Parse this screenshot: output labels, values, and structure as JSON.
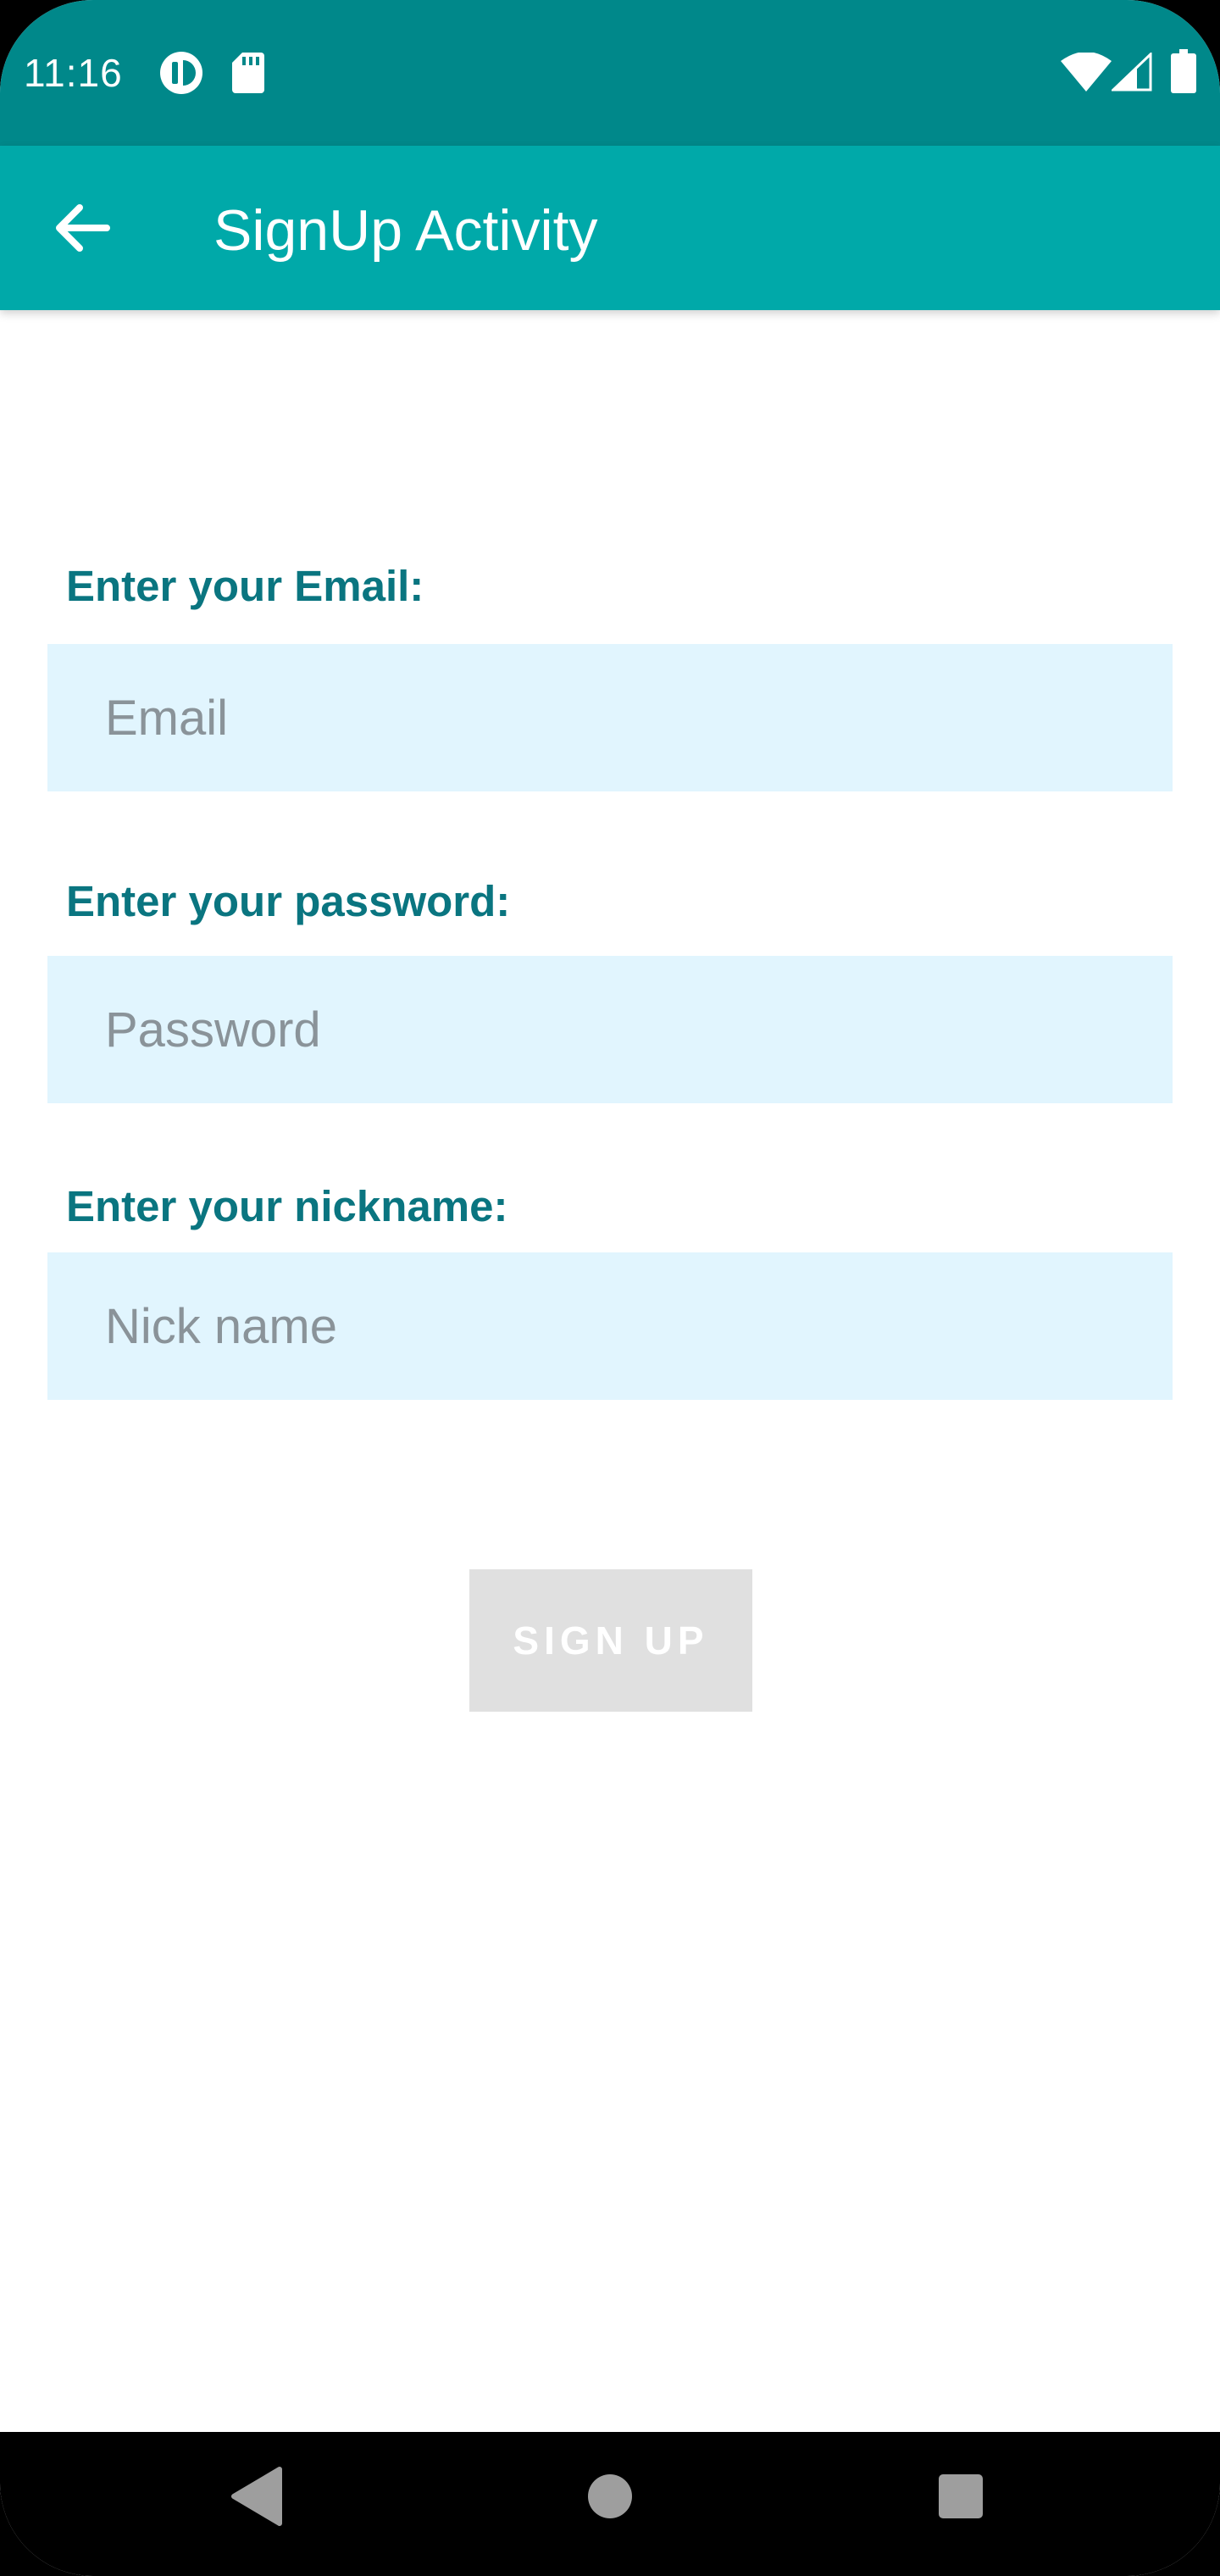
{
  "status_bar": {
    "time": "11:16",
    "icons": [
      "data-saver-icon",
      "sd-card-icon",
      "wifi-icon",
      "cell-signal-icon",
      "battery-icon"
    ]
  },
  "app_bar": {
    "title": "SignUp Activity",
    "back_icon": "arrow-back-icon",
    "color": "#00a9a9"
  },
  "form": {
    "email": {
      "label": "Enter your Email:",
      "placeholder": "Email",
      "value": ""
    },
    "password": {
      "label": "Enter your password:",
      "placeholder": "Password",
      "value": ""
    },
    "nickname": {
      "label": "Enter your nickname:",
      "placeholder": "Nick name",
      "value": ""
    },
    "signup_label": "SIGN UP"
  },
  "nav_bar": {
    "icons": [
      "nav-back-icon",
      "nav-home-icon",
      "nav-recents-icon"
    ]
  },
  "colors": {
    "status_bar": "#00888a",
    "label_text": "#0a7580",
    "field_background": "#e1f5fe",
    "button_disabled": "#e0e0e0"
  }
}
